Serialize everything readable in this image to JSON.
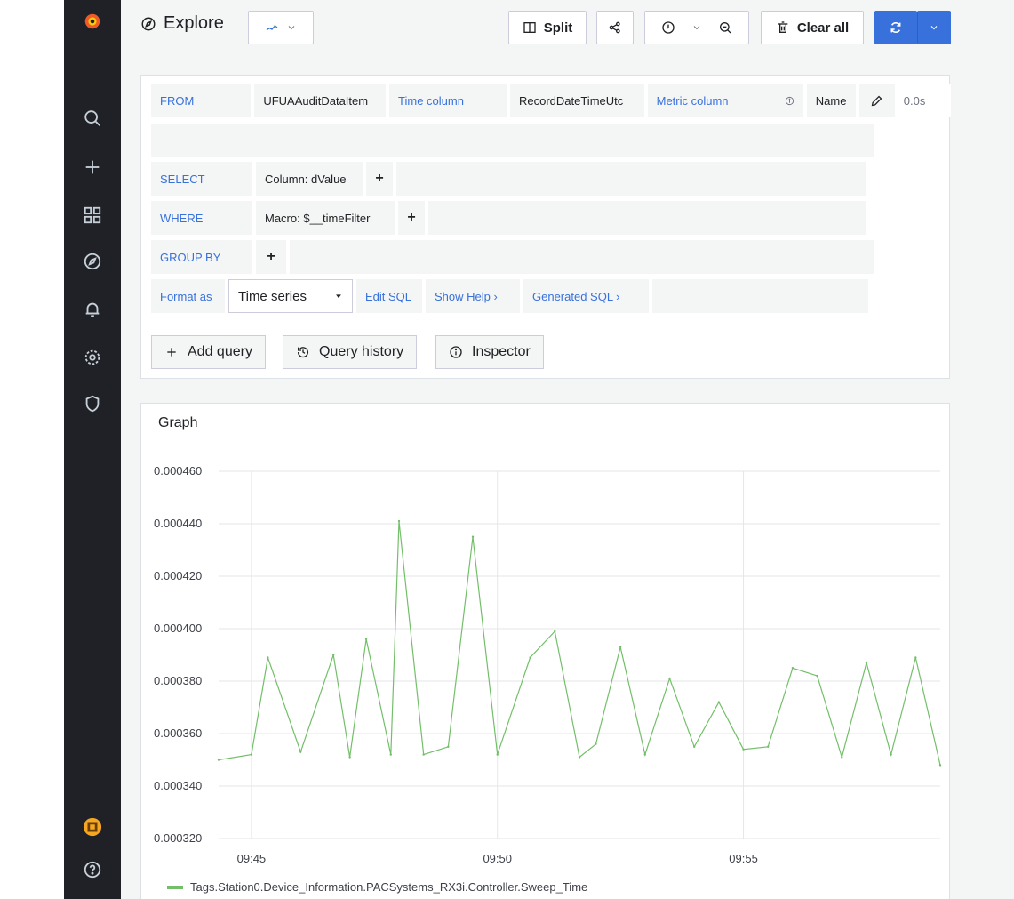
{
  "app": {
    "title": "Explore"
  },
  "toolbar": {
    "split_label": "Split",
    "clear_all_label": "Clear all"
  },
  "query": {
    "from_label": "FROM",
    "from_value": "UFUAAuditDataItem",
    "time_column_label": "Time column",
    "time_column_value": "RecordDateTimeUtc",
    "metric_column_label": "Metric column",
    "metric_column_value": "Name",
    "duration": "0.0s",
    "select_label": "SELECT",
    "select_value": "Column: dValue",
    "where_label": "WHERE",
    "where_value": "Macro: $__timeFilter",
    "group_by_label": "GROUP BY",
    "format_as_label": "Format as",
    "format_as_value": "Time series",
    "edit_sql_label": "Edit SQL",
    "show_help_label": "Show Help ›",
    "generated_sql_label": "Generated SQL ›"
  },
  "actions": {
    "add_query": "Add query",
    "query_history": "Query history",
    "inspector": "Inspector"
  },
  "graph": {
    "title": "Graph"
  },
  "chart_data": {
    "type": "line",
    "title": "Graph",
    "xlabel": "",
    "ylabel": "",
    "x_ticks": [
      "09:45",
      "09:50",
      "09:55"
    ],
    "y_ticks": [
      "0.000320",
      "0.000340",
      "0.000360",
      "0.000380",
      "0.000400",
      "0.000420",
      "0.000440",
      "0.000460"
    ],
    "ylim": [
      0.00032,
      0.00046
    ],
    "xlim": [
      "09:44:20",
      "09:59:00"
    ],
    "grid": true,
    "legend_position": "bottom-left",
    "series": [
      {
        "name": "Tags.Station0.Device_Information.PACSystems_RX3i.Controller.Sweep_Time",
        "color": "#73bf69",
        "x": [
          "09:44:20",
          "09:45:00",
          "09:45:20",
          "09:46:00",
          "09:46:40",
          "09:47:00",
          "09:47:20",
          "09:47:50",
          "09:48:00",
          "09:48:30",
          "09:49:00",
          "09:49:30",
          "09:50:00",
          "09:50:40",
          "09:51:10",
          "09:51:40",
          "09:52:00",
          "09:52:30",
          "09:53:00",
          "09:53:30",
          "09:54:00",
          "09:54:30",
          "09:55:00",
          "09:55:30",
          "09:56:00",
          "09:56:30",
          "09:57:00",
          "09:57:30",
          "09:58:00",
          "09:58:30",
          "09:59:00"
        ],
        "values": [
          0.00035,
          0.000352,
          0.000389,
          0.000353,
          0.00039,
          0.000351,
          0.000396,
          0.000352,
          0.000441,
          0.000352,
          0.000355,
          0.000435,
          0.000352,
          0.000389,
          0.000399,
          0.000351,
          0.000356,
          0.000393,
          0.000352,
          0.000381,
          0.000355,
          0.000372,
          0.000354,
          0.000355,
          0.000385,
          0.000382,
          0.000351,
          0.000387,
          0.000352,
          0.000389,
          0.000348
        ]
      }
    ]
  }
}
